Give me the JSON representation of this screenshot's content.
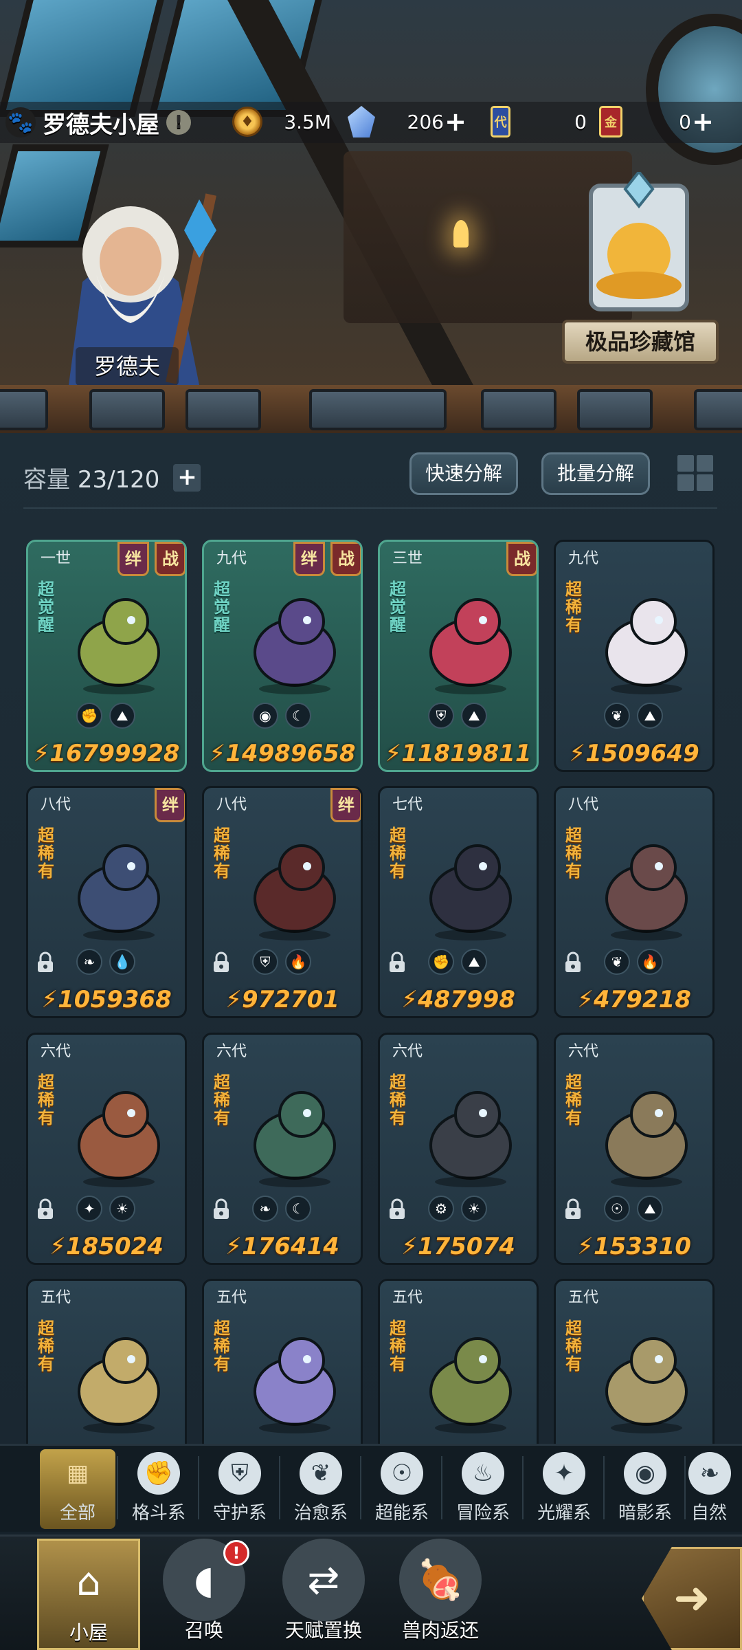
{
  "header": {
    "title": "罗德夫小屋",
    "coins": "3.5M",
    "crystals": "206",
    "card_dai_count": "0",
    "card_dai_glyph": "代",
    "card_jin_count": "0",
    "card_jin_glyph": "金"
  },
  "scene": {
    "npc_name": "罗德夫",
    "museum_label": "极品珍藏馆"
  },
  "storage": {
    "capacity_label": "容量",
    "capacity_value": "23/120",
    "quick_decompose": "快速分解",
    "batch_decompose": "批量分解"
  },
  "cards": [
    {
      "gen": "一世",
      "rarity": "超觉醒",
      "awakened": true,
      "bond": "绊",
      "battle": "战",
      "power": "16799928",
      "traits": [
        "fist-icon",
        "rock-icon"
      ],
      "locked": false,
      "color": "#8fa44a"
    },
    {
      "gen": "九代",
      "rarity": "超觉醒",
      "awakened": true,
      "bond": "绊",
      "battle": "战",
      "power": "14989658",
      "traits": [
        "eye-icon",
        "moon-icon"
      ],
      "locked": false,
      "color": "#5a4a8a"
    },
    {
      "gen": "三世",
      "rarity": "超觉醒",
      "awakened": true,
      "bond": "",
      "battle": "战",
      "power": "11819811",
      "traits": [
        "shield-icon",
        "rock-icon"
      ],
      "locked": false,
      "color": "#c2415a"
    },
    {
      "gen": "九代",
      "rarity": "超稀有",
      "awakened": false,
      "bond": "",
      "battle": "",
      "power": "1509649",
      "traits": [
        "leaf-icon",
        "rock-icon"
      ],
      "locked": false,
      "color": "#e9e4ec"
    },
    {
      "gen": "八代",
      "rarity": "超稀有",
      "awakened": false,
      "bond": "绊",
      "battle": "",
      "power": "1059368",
      "traits": [
        "leaf-flame-icon",
        "drop-icon"
      ],
      "locked": true,
      "color": "#3d4e74"
    },
    {
      "gen": "八代",
      "rarity": "超稀有",
      "awakened": false,
      "bond": "绊",
      "battle": "",
      "power": "972701",
      "traits": [
        "shield-icon",
        "flame-icon"
      ],
      "locked": true,
      "color": "#5a2a2a"
    },
    {
      "gen": "七代",
      "rarity": "超稀有",
      "awakened": false,
      "bond": "",
      "battle": "",
      "power": "487998",
      "traits": [
        "fist-icon",
        "rock-icon"
      ],
      "locked": true,
      "color": "#2e3040"
    },
    {
      "gen": "八代",
      "rarity": "超稀有",
      "awakened": false,
      "bond": "",
      "battle": "",
      "power": "479218",
      "traits": [
        "leaf-icon",
        "flame-icon"
      ],
      "locked": true,
      "color": "#6a4a4a"
    },
    {
      "gen": "六代",
      "rarity": "超稀有",
      "awakened": false,
      "bond": "",
      "battle": "",
      "power": "185024",
      "traits": [
        "compass-icon",
        "sun-icon"
      ],
      "locked": true,
      "color": "#9a5a40"
    },
    {
      "gen": "六代",
      "rarity": "超稀有",
      "awakened": false,
      "bond": "",
      "battle": "",
      "power": "176414",
      "traits": [
        "leaf-flame-icon",
        "moon-icon"
      ],
      "locked": true,
      "color": "#3e6a5a"
    },
    {
      "gen": "六代",
      "rarity": "超稀有",
      "awakened": false,
      "bond": "",
      "battle": "",
      "power": "175074",
      "traits": [
        "gear-icon",
        "sun-icon"
      ],
      "locked": true,
      "color": "#3a3f48"
    },
    {
      "gen": "六代",
      "rarity": "超稀有",
      "awakened": false,
      "bond": "",
      "battle": "",
      "power": "153310",
      "traits": [
        "alien-icon",
        "rock-icon"
      ],
      "locked": true,
      "color": "#8a7a5a"
    },
    {
      "gen": "五代",
      "rarity": "超稀有",
      "awakened": false,
      "bond": "",
      "battle": "",
      "power": "",
      "traits": [],
      "locked": false,
      "color": "#c2ab6a"
    },
    {
      "gen": "五代",
      "rarity": "超稀有",
      "awakened": false,
      "bond": "",
      "battle": "",
      "power": "",
      "traits": [],
      "locked": false,
      "color": "#8a82c9"
    },
    {
      "gen": "五代",
      "rarity": "超稀有",
      "awakened": false,
      "bond": "",
      "battle": "",
      "power": "",
      "traits": [],
      "locked": false,
      "color": "#7a8a4a"
    },
    {
      "gen": "五代",
      "rarity": "超稀有",
      "awakened": false,
      "bond": "",
      "battle": "",
      "power": "",
      "traits": [],
      "locked": false,
      "color": "#a89a6a"
    }
  ],
  "categories": [
    {
      "label": "全部",
      "icon": "blocks-icon",
      "glyph": "▦",
      "active": true
    },
    {
      "label": "格斗系",
      "icon": "fist-icon",
      "glyph": "✊",
      "active": false
    },
    {
      "label": "守护系",
      "icon": "shield-icon",
      "glyph": "⛨",
      "active": false
    },
    {
      "label": "治愈系",
      "icon": "leaf-icon",
      "glyph": "❦",
      "active": false
    },
    {
      "label": "超能系",
      "icon": "alien-icon",
      "glyph": "☉",
      "active": false
    },
    {
      "label": "冒险系",
      "icon": "flame-icon",
      "glyph": "♨",
      "active": false
    },
    {
      "label": "光耀系",
      "icon": "compass-icon",
      "glyph": "✦",
      "active": false
    },
    {
      "label": "暗影系",
      "icon": "eye-icon",
      "glyph": "◉",
      "active": false
    },
    {
      "label": "自然",
      "icon": "leaf-flame-icon",
      "glyph": "❧",
      "active": false
    }
  ],
  "nav": [
    {
      "label": "小屋",
      "icon": "house-icon",
      "glyph": "⌂",
      "active": true
    },
    {
      "label": "召唤",
      "icon": "egg-icon",
      "glyph": "◖",
      "active": false,
      "badge": "!"
    },
    {
      "label": "天赋置换",
      "icon": "swap-icon",
      "glyph": "⇄",
      "active": false
    },
    {
      "label": "兽肉返还",
      "icon": "meat-icon",
      "glyph": "🍖",
      "active": false
    }
  ],
  "colors": {
    "power": "#ffb43a",
    "rarity": "#f3b23a",
    "awakened": "#6fd3c4",
    "accent_gold": "#c2a24a"
  }
}
